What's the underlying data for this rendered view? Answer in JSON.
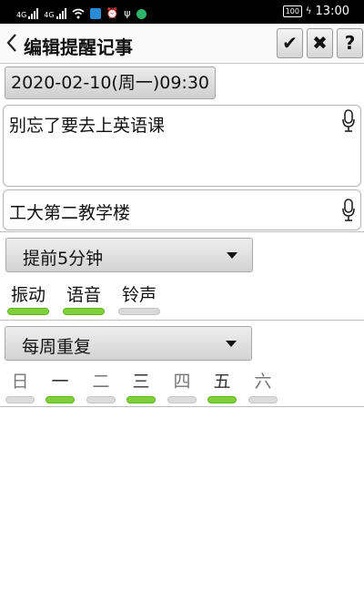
{
  "status_bar": {
    "signal1_label": "4G",
    "signal2_label": "4G",
    "battery": "100",
    "time": "13:00",
    "icons": [
      "signal-icon",
      "signal-icon",
      "wifi-icon",
      "app-icon",
      "alarm-icon",
      "usb-icon",
      "app-dot-icon"
    ]
  },
  "header": {
    "title": "编辑提醒记事",
    "confirm_label": "✔",
    "cancel_label": "✖",
    "help_label": "?"
  },
  "reminder": {
    "datetime": "2020-02-10(周一)09:30",
    "content": "别忘了要去上英语课",
    "location": "工大第二教学楼"
  },
  "alert": {
    "advance": "提前5分钟",
    "modes": [
      {
        "label": "振动",
        "on": true
      },
      {
        "label": "语音",
        "on": true
      },
      {
        "label": "铃声",
        "on": false
      }
    ]
  },
  "repeat": {
    "mode": "每周重复",
    "days": [
      {
        "label": "日",
        "on": false
      },
      {
        "label": "一",
        "on": true
      },
      {
        "label": "二",
        "on": false
      },
      {
        "label": "三",
        "on": true
      },
      {
        "label": "四",
        "on": false
      },
      {
        "label": "五",
        "on": true
      },
      {
        "label": "六",
        "on": false
      }
    ]
  },
  "colors": {
    "toggle_on": "#7fd13b",
    "toggle_off": "#d9d9d9",
    "statusbar": "#000000"
  }
}
